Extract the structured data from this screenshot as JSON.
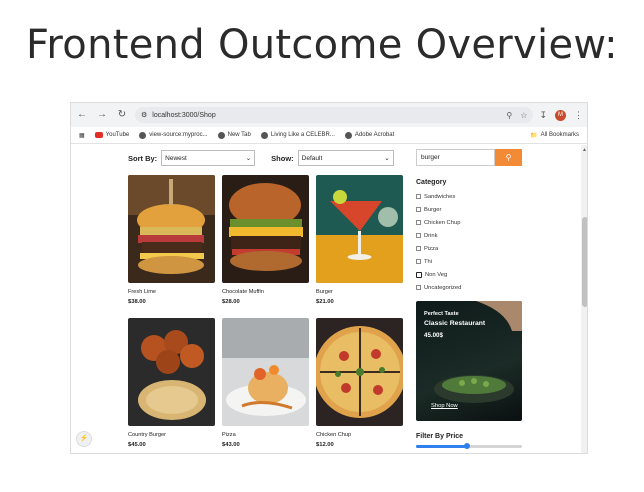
{
  "slide": {
    "title": "Frontend Outcome Overview:"
  },
  "browser": {
    "url": "localhost:3000/Shop",
    "bookmarks": [
      "YouTube",
      "view-source:myproc...",
      "New Tab",
      "Living Like a CELEBR...",
      "Adobe Acrobat"
    ],
    "all_bookmarks": "All Bookmarks",
    "avatar_letter": "M"
  },
  "shop": {
    "sort_label": "Sort By:",
    "sort_value": "Newest",
    "show_label": "Show:",
    "show_value": "Default",
    "products": [
      {
        "name": "Fresh Lime",
        "price": "$38.00"
      },
      {
        "name": "Chocolate Muffin",
        "price": "$28.00"
      },
      {
        "name": "Burger",
        "price": "$21.00"
      },
      {
        "name": "Country Burger",
        "price": "$45.00"
      },
      {
        "name": "Pizza",
        "price": "$43.00"
      },
      {
        "name": "Chicken Chup",
        "price": "$12.00"
      }
    ]
  },
  "sidebar": {
    "search_value": "burger",
    "category_title": "Category",
    "categories": [
      "Sandwiches",
      "Burger",
      "Chicken Chup",
      "Drink",
      "Pizza",
      "Thi",
      "Non Veg",
      "Uncategorized"
    ],
    "promo": {
      "tag": "Perfect Taste",
      "title": "Classic Restaurant",
      "price": "45.00$",
      "link": "Shop Now"
    },
    "filter_title": "Filter By Price",
    "price_fraction": 0.48
  }
}
